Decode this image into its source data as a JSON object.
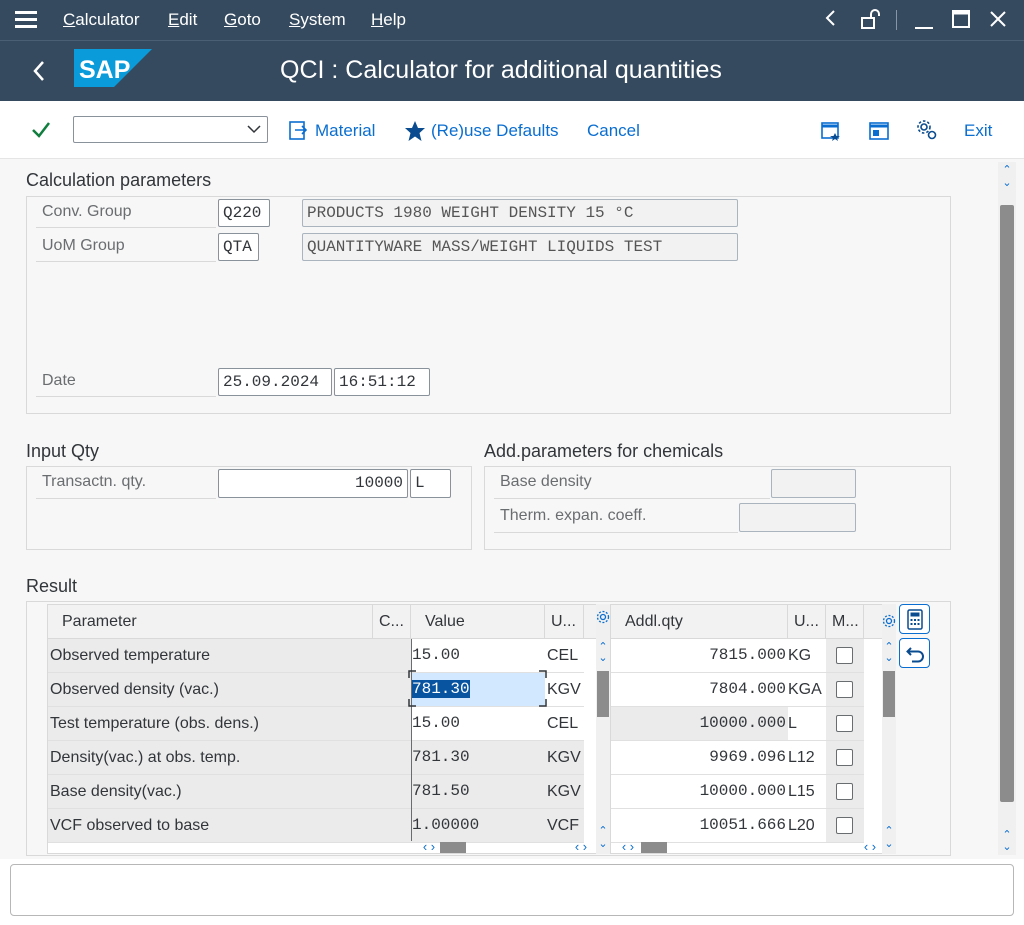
{
  "menu": {
    "items": [
      "Calculator",
      "Edit",
      "Goto",
      "System",
      "Help"
    ],
    "hamburger_icon": "menu-icon"
  },
  "window_controls": [
    "chevron-left-icon",
    "unlock-icon",
    "minimize-icon",
    "maximize-icon",
    "close-icon"
  ],
  "header": {
    "logo": "SAP",
    "title": "QCI : Calculator for additional quantities"
  },
  "toolbar": {
    "command_field_value": "",
    "material_label": "Material",
    "defaults_label": "(Re)use Defaults",
    "cancel_label": "Cancel",
    "exit_label": "Exit"
  },
  "calc_params": {
    "title": "Calculation parameters",
    "conv_group_label": "Conv. Group",
    "conv_group_value": "Q220",
    "conv_group_desc": "PRODUCTS 1980 WEIGHT DENSITY 15 °C",
    "uom_group_label": "UoM Group",
    "uom_group_value": "QTA",
    "uom_group_desc": "QUANTITYWARE MASS/WEIGHT LIQUIDS TEST",
    "date_label": "Date",
    "date_value": "25.09.2024",
    "time_value": "16:51:12"
  },
  "input_qty": {
    "title": "Input Qty",
    "transaction_label": "Transactn. qty.",
    "transaction_value": "10000",
    "transaction_unit": "L"
  },
  "chem_params": {
    "title": "Add.parameters for chemicals",
    "base_density_label": "Base density",
    "base_density_value": "",
    "therm_label": "Therm. expan. coeff.",
    "therm_value": ""
  },
  "result": {
    "title": "Result",
    "left_headers": {
      "parameter": "Parameter",
      "c": "C...",
      "value": "Value",
      "unit": "U..."
    },
    "right_headers": {
      "addl": "Addl.qty",
      "unit": "U...",
      "m": "M..."
    },
    "rows": [
      {
        "parameter": "Observed temperature",
        "value": "15.00",
        "unit": "CEL",
        "addl": "7815.000",
        "addl_unit": "KG",
        "editable": true
      },
      {
        "parameter": "Observed density (vac.)",
        "value": "781.30",
        "unit": "KGV",
        "addl": "7804.000",
        "addl_unit": "KGA",
        "editable": true
      },
      {
        "parameter": "Test temperature (obs. dens.)",
        "value": "15.00",
        "unit": "CEL",
        "addl": "10000.000",
        "addl_unit": "L",
        "editable": true
      },
      {
        "parameter": "Density(vac.) at obs. temp.",
        "value": "781.30",
        "unit": "KGV",
        "addl": "9969.096",
        "addl_unit": "L12",
        "editable": false
      },
      {
        "parameter": "Base density(vac.)",
        "value": "781.50",
        "unit": "KGV",
        "addl": "10000.000",
        "addl_unit": "L15",
        "editable": false
      },
      {
        "parameter": "VCF observed to base",
        "value": "1.00000",
        "unit": "VCF",
        "addl": "10051.666",
        "addl_unit": "L20",
        "editable": false
      }
    ]
  },
  "colors": {
    "shell": "#354a5f",
    "accent": "#0a6ed1",
    "check": "#107e3e",
    "selection": "#0854a0"
  }
}
